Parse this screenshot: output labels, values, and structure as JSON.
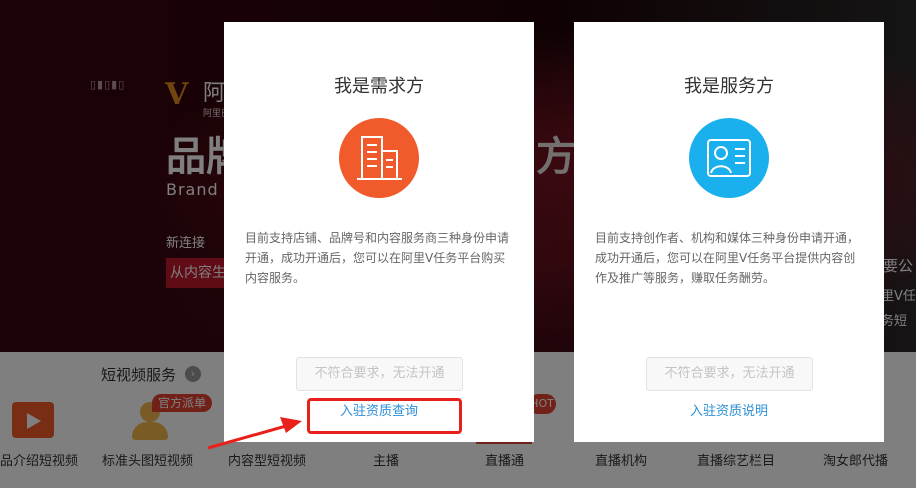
{
  "background": {
    "banner": {
      "logo_dots": "▯▮▯▮▯",
      "logo_v": "V",
      "logo_cn": "阿",
      "logo_sub": "阿里巴",
      "headline_left": "品牌",
      "headline_right": "方案",
      "brand_en": "Brand",
      "new_link": "新连接",
      "tag_text": "从内容生",
      "right_text_1": "需要公",
      "right_text_2": "阿里V任",
      "right_text_3": "任务短"
    },
    "services": {
      "title": "短视频服务",
      "arrow": "›",
      "official_tag": "官方派单",
      "hot_tag": "HOT",
      "items": [
        "品介绍短视频",
        "标准头图短视频",
        "内容型短视频",
        "主播",
        "直播通",
        "直播机构",
        "直播综艺栏目",
        "淘女郎代播"
      ]
    }
  },
  "cards": {
    "demand": {
      "title": "我是需求方",
      "icon": "building-icon",
      "description": "目前支持店铺、品牌号和内容服务商三种身份申请开通，成功开通后，您可以在阿里V任务平台购买内容服务。",
      "button_label": "不符合要求，无法开通",
      "link_label": "入驻资质查询"
    },
    "service": {
      "title": "我是服务方",
      "icon": "person-card-icon",
      "description": "目前支持创作者、机构和媒体三种身份申请开通，成功开通后，您可以在阿里V任务平台提供内容创作及推广等服务，赚取任务酬劳。",
      "button_label": "不符合要求，无法开通",
      "link_label": "入驻资质说明"
    }
  },
  "colors": {
    "demand_icon_bg": "#f15a2b",
    "service_icon_bg": "#1ab0ed",
    "link": "#2c8fd6",
    "annotation_red": "#e8201c"
  }
}
